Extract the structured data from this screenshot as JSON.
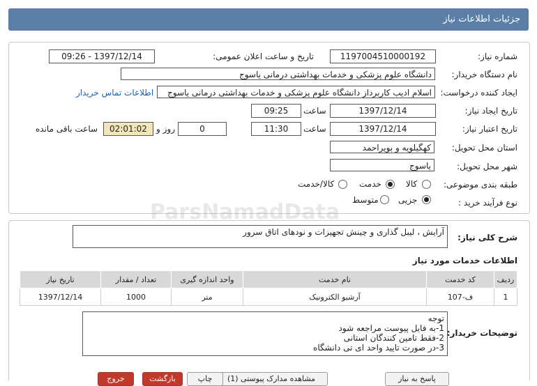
{
  "title": "جزئیات اطلاعات نیاز",
  "fields": {
    "need_number_label": "شماره نیاز:",
    "need_number": "1197004510000192",
    "announce_label": "تاریخ و ساعت اعلان عمومی:",
    "announce_value": "1397/12/14 - 09:26",
    "buyer_org_label": "نام دستگاه خریدار:",
    "buyer_org": "دانشگاه علوم پزشکی و خدمات بهداشتی درمانی یاسوج",
    "creator_label": "ایجاد کننده درخواست:",
    "creator": "اسلام  ادیب کاربرداز دانشگاه علوم پزشکی و خدمات بهداشتی درمانی یاسوج",
    "contact_link": "اطلاعات تماس خریدار",
    "created_date_label": "تاریخ ایجاد نیاز:",
    "created_date": "1397/12/14",
    "time_label": "ساعت",
    "created_time": "09:25",
    "validity_label": "تاریخ اعتبار نیاز:",
    "validity_date": "1397/12/14",
    "validity_time": "11:30",
    "days_value": "0",
    "day_and_label": "روز و",
    "remaining_time": "02:01:02",
    "remaining_label": "ساعت باقی مانده",
    "province_label": "استان محل تحویل:",
    "province": "کهگیلویه و بویراحمد",
    "city_label": "شهر محل تحویل:",
    "city": "یاسوج",
    "category_label": "طبقه بندی موضوعی:",
    "category_options": [
      "کالا",
      "خدمت",
      "کالا/خدمت"
    ],
    "category_selected": "خدمت",
    "process_label": "نوع فرآیند خرید :",
    "process_options": [
      "جزیی",
      "متوسط"
    ],
    "process_selected": "جزیی"
  },
  "summary_label": "شرح کلی نیاز:",
  "summary": "آرایش ، لیبل گذاری و چینش تجهیزات و نودهای اتاق سرور",
  "services_title": "اطلاعات خدمات مورد نیاز",
  "services_table": {
    "headers": [
      "ردیف",
      "کد خدمت",
      "نام خدمت",
      "واحد اندازه گیری",
      "تعداد / مقدار",
      "تاریخ نیاز"
    ],
    "rows": [
      [
        "1",
        "ف-107",
        "آرشیو الکترونیک",
        "متر",
        "1000",
        "1397/12/14"
      ]
    ]
  },
  "buyer_notes_label": "توضیحات خریدار:",
  "buyer_notes": [
    "توجه",
    "1-به فایل پیوست مراجعه شود",
    "2-فقط تامین کنندگان استانی",
    "3-در صورت تایید واحد ای تی دانشگاه"
  ],
  "watermark": "ParsNamadData",
  "buttons": [
    "پاسخ به نیاز",
    "مشاهده مدارک پیوستی (1)",
    "چاپ",
    "بازگشت",
    "خروج"
  ],
  "colors": {
    "titlebar": "#5b7fa6",
    "highlight": "#f1e6b8",
    "link": "#1a5fb4",
    "exit": "#c0392b"
  }
}
